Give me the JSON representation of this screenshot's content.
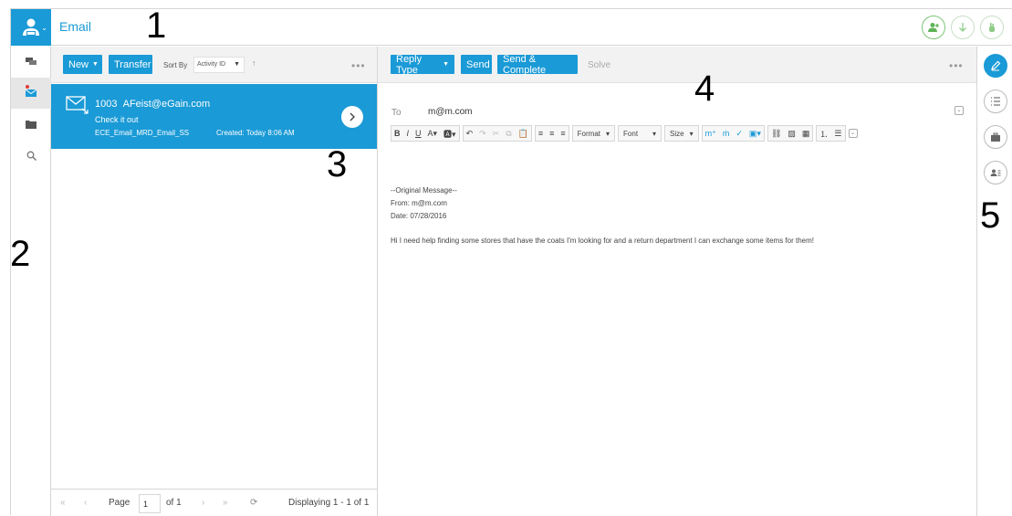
{
  "header": {
    "title": "Email"
  },
  "leftnav": {
    "items": [
      "chat-icon",
      "email-icon",
      "folder-icon",
      "search-icon"
    ]
  },
  "list_toolbar": {
    "new_label": "New",
    "transfer_label": "Transfer",
    "sort_by_label": "Sort By",
    "sort_value": "Activity ID"
  },
  "activity": {
    "id": "1003",
    "from": "AFeist@eGain.com",
    "subject": "Check it out",
    "queue": "ECE_Email_MRD_Email_SS",
    "created": "Created: Today 8:06 AM"
  },
  "pager": {
    "page_label": "Page",
    "page_value": "1",
    "of_label": "of 1",
    "displaying": "Displaying 1 - 1 of 1"
  },
  "editor_toolbar": {
    "reply_type_label": "Reply Type",
    "send_label": "Send",
    "send_complete_label": "Send & Complete",
    "solve_label": "Solve"
  },
  "message": {
    "to_label": "To",
    "to_value": "m@m.com",
    "format_label": "Format",
    "font_label": "Font",
    "size_label": "Size",
    "body": [
      "--Original Message--",
      "From: m@m.com",
      "Date: 07/28/2016",
      "Hi I need help finding some stores that have the coats I'm looking for and a return department I can exchange some items for them!"
    ]
  },
  "callouts": [
    "1",
    "2",
    "3",
    "4",
    "5"
  ]
}
